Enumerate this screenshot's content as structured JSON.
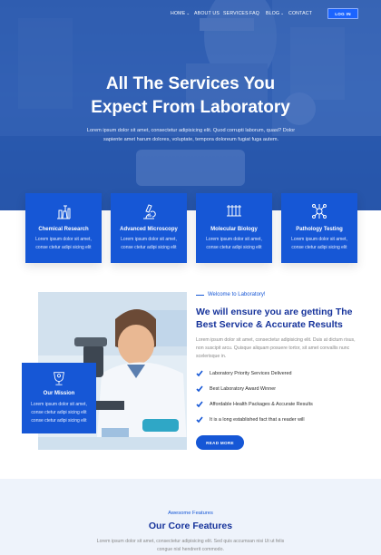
{
  "nav": {
    "items": [
      {
        "label": "HOME",
        "has_dropdown": true
      },
      {
        "label": "ABOUT US",
        "has_dropdown": false
      },
      {
        "label": "SERVICES",
        "has_dropdown": false
      },
      {
        "label": "FAQ",
        "has_dropdown": false
      },
      {
        "label": "BLOG",
        "has_dropdown": true
      },
      {
        "label": "CONTACT",
        "has_dropdown": false
      }
    ],
    "login_label": "LOG IN"
  },
  "hero": {
    "title_line1": "All The Services You",
    "title_line2": "Expect From Laboratory",
    "text": "Lorem ipsum dolor sit amet, consectetur adipisicing elit. Quod corrupti laborum, quasi? Dolor sapiente amet harum dolores, voluptate, tempora doloreum fugiat fuga autem."
  },
  "services": [
    {
      "title": "Chemical Research",
      "desc": "Lorem ipsum dolor sit amet, conse ctetur adipi sicing elit",
      "icon": "chemistry-flasks-icon"
    },
    {
      "title": "Advanced Microscopy",
      "desc": "Lorem ipsum dolor sit amet, conse ctetur adipi sicing elit",
      "icon": "microscope-icon"
    },
    {
      "title": "Molecular Biology",
      "desc": "Lorem ipsum dolor sit amet, conse ctetur adipi sicing elit",
      "icon": "test-tubes-icon"
    },
    {
      "title": "Pathology Testing",
      "desc": "Lorem ipsum dolor sit amet, conse ctetur adipi sicing elit",
      "icon": "molecule-icon"
    }
  ],
  "mission": {
    "title": "Our Mission",
    "desc": "Lorem ipsum dolor sit amet, conse ctetur adipi sicing elit conse ctetur adipi sicing elit"
  },
  "about": {
    "label": "Welcome to Laboratory!",
    "title": "We will ensure you are getting The Best Service & Accurate Results",
    "text": "Lorem ipsum dolor sit amet, consectetur adipisicing elit. Duis at dictum risus, non suscipit arcu. Quisque aliquam posuere tortor, sit amet convallis nunc scelerisque in.",
    "checklist": [
      "Laboratory Priority Services Delivered",
      "Best Laboratory Award Winner",
      "Affordable Health Packages & Accurate Results",
      "It is a long established fact that a reader will"
    ],
    "button_label": "READ MORE"
  },
  "features": {
    "label": "Awesome Features",
    "title": "Our Core Features",
    "text": "Lorem ipsum dolor sit amet, consectetur adipisicing elit. Sed quis accumsan nisi Ut ut felis congue nisl hendrerit commodo."
  },
  "colors": {
    "primary": "#1657d6",
    "heading": "#16339b",
    "hero_overlay": "#1c4caa"
  }
}
